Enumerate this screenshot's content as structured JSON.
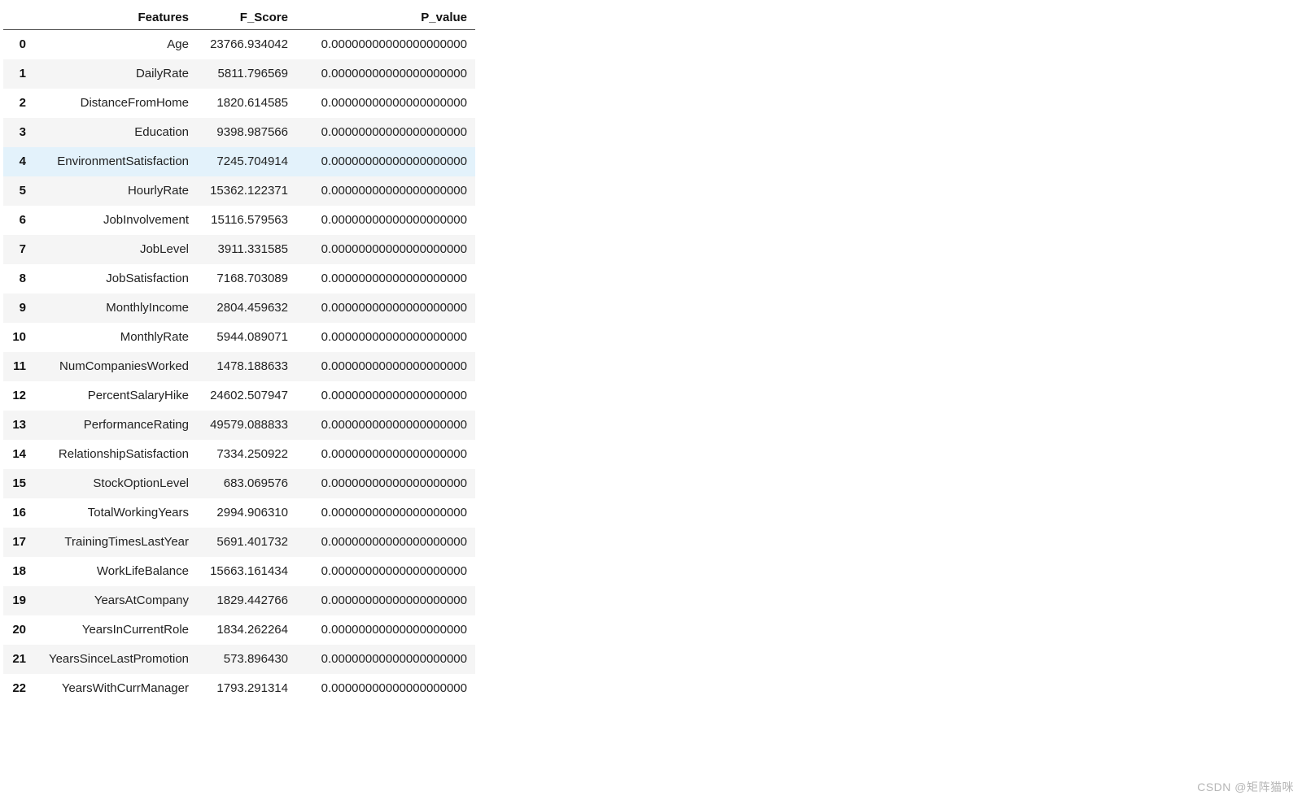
{
  "columns": {
    "index": "",
    "features": "Features",
    "f_score": "F_Score",
    "p_value": "P_value"
  },
  "highlight_index": 4,
  "rows": [
    {
      "idx": "0",
      "feature": "Age",
      "f_score": "23766.934042",
      "p_value": "0.00000000000000000000"
    },
    {
      "idx": "1",
      "feature": "DailyRate",
      "f_score": "5811.796569",
      "p_value": "0.00000000000000000000"
    },
    {
      "idx": "2",
      "feature": "DistanceFromHome",
      "f_score": "1820.614585",
      "p_value": "0.00000000000000000000"
    },
    {
      "idx": "3",
      "feature": "Education",
      "f_score": "9398.987566",
      "p_value": "0.00000000000000000000"
    },
    {
      "idx": "4",
      "feature": "EnvironmentSatisfaction",
      "f_score": "7245.704914",
      "p_value": "0.00000000000000000000"
    },
    {
      "idx": "5",
      "feature": "HourlyRate",
      "f_score": "15362.122371",
      "p_value": "0.00000000000000000000"
    },
    {
      "idx": "6",
      "feature": "JobInvolvement",
      "f_score": "15116.579563",
      "p_value": "0.00000000000000000000"
    },
    {
      "idx": "7",
      "feature": "JobLevel",
      "f_score": "3911.331585",
      "p_value": "0.00000000000000000000"
    },
    {
      "idx": "8",
      "feature": "JobSatisfaction",
      "f_score": "7168.703089",
      "p_value": "0.00000000000000000000"
    },
    {
      "idx": "9",
      "feature": "MonthlyIncome",
      "f_score": "2804.459632",
      "p_value": "0.00000000000000000000"
    },
    {
      "idx": "10",
      "feature": "MonthlyRate",
      "f_score": "5944.089071",
      "p_value": "0.00000000000000000000"
    },
    {
      "idx": "11",
      "feature": "NumCompaniesWorked",
      "f_score": "1478.188633",
      "p_value": "0.00000000000000000000"
    },
    {
      "idx": "12",
      "feature": "PercentSalaryHike",
      "f_score": "24602.507947",
      "p_value": "0.00000000000000000000"
    },
    {
      "idx": "13",
      "feature": "PerformanceRating",
      "f_score": "49579.088833",
      "p_value": "0.00000000000000000000"
    },
    {
      "idx": "14",
      "feature": "RelationshipSatisfaction",
      "f_score": "7334.250922",
      "p_value": "0.00000000000000000000"
    },
    {
      "idx": "15",
      "feature": "StockOptionLevel",
      "f_score": "683.069576",
      "p_value": "0.00000000000000000000"
    },
    {
      "idx": "16",
      "feature": "TotalWorkingYears",
      "f_score": "2994.906310",
      "p_value": "0.00000000000000000000"
    },
    {
      "idx": "17",
      "feature": "TrainingTimesLastYear",
      "f_score": "5691.401732",
      "p_value": "0.00000000000000000000"
    },
    {
      "idx": "18",
      "feature": "WorkLifeBalance",
      "f_score": "15663.161434",
      "p_value": "0.00000000000000000000"
    },
    {
      "idx": "19",
      "feature": "YearsAtCompany",
      "f_score": "1829.442766",
      "p_value": "0.00000000000000000000"
    },
    {
      "idx": "20",
      "feature": "YearsInCurrentRole",
      "f_score": "1834.262264",
      "p_value": "0.00000000000000000000"
    },
    {
      "idx": "21",
      "feature": "YearsSinceLastPromotion",
      "f_score": "573.896430",
      "p_value": "0.00000000000000000000"
    },
    {
      "idx": "22",
      "feature": "YearsWithCurrManager",
      "f_score": "1793.291314",
      "p_value": "0.00000000000000000000"
    }
  ],
  "watermark": "CSDN @矩阵猫咪"
}
